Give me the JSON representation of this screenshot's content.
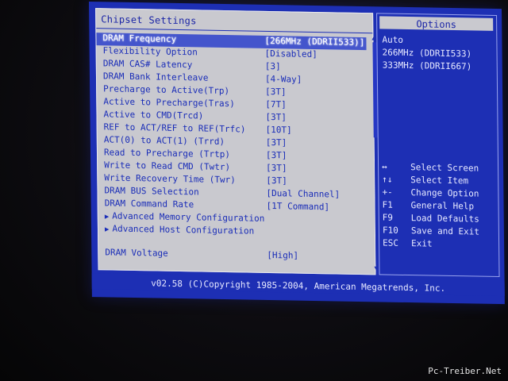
{
  "main": {
    "title": "Chipset Settings",
    "settings": [
      {
        "label": "DRAM Frequency",
        "value": "[266MHz (DDRII533)]"
      },
      {
        "label": "Flexibility Option",
        "value": "[Disabled]"
      },
      {
        "label": "DRAM CAS# Latency",
        "value": "[3]"
      },
      {
        "label": "DRAM Bank Interleave",
        "value": "[4-Way]"
      },
      {
        "label": "Precharge to Active(Trp)",
        "value": "[3T]"
      },
      {
        "label": "Active to Precharge(Tras)",
        "value": "[7T]"
      },
      {
        "label": "Active to CMD(Trcd)",
        "value": "[3T]"
      },
      {
        "label": "REF to ACT/REF to REF(Trfc)",
        "value": "[10T]"
      },
      {
        "label": "ACT(0) to ACT(1) (Trrd)",
        "value": "[3T]"
      },
      {
        "label": "Read to Precharge (Trtp)",
        "value": "[3T]"
      },
      {
        "label": "Write to Read CMD (Twtr)",
        "value": "[3T]"
      },
      {
        "label": "Write Recovery Time (Twr)",
        "value": "[3T]"
      },
      {
        "label": "DRAM BUS Selection",
        "value": "[Dual Channel]"
      },
      {
        "label": "DRAM Command Rate",
        "value": "[1T Command]"
      }
    ],
    "submenus": [
      {
        "label": "Advanced Memory Configuration",
        "marker": "▶"
      },
      {
        "label": "Advanced Host Configuration",
        "marker": "▶"
      }
    ],
    "voltage": {
      "label": "DRAM Voltage",
      "value": "[High]"
    },
    "scroll_up": "▲",
    "scroll_down": "▼"
  },
  "options": {
    "title": "Options",
    "items": [
      "Auto",
      "266MHz (DDRII533)",
      "333MHz (DDRII667)"
    ]
  },
  "help": [
    {
      "key": "↔",
      "desc": "Select Screen"
    },
    {
      "key": "↑↓",
      "desc": "Select Item"
    },
    {
      "key": "+-",
      "desc": "Change Option"
    },
    {
      "key": "F1",
      "desc": "General Help"
    },
    {
      "key": "F9",
      "desc": "Load Defaults"
    },
    {
      "key": "F10",
      "desc": "Save and Exit"
    },
    {
      "key": "ESC",
      "desc": "Exit"
    }
  ],
  "footer": "v02.58 (C)Copyright 1985-2004, American Megatrends, Inc.",
  "watermark": "Pc-Treiber.Net",
  "colors": {
    "bios_blue": "#1d2fb4",
    "panel_gray": "#c9c9cf",
    "highlight": "#ffffff"
  }
}
